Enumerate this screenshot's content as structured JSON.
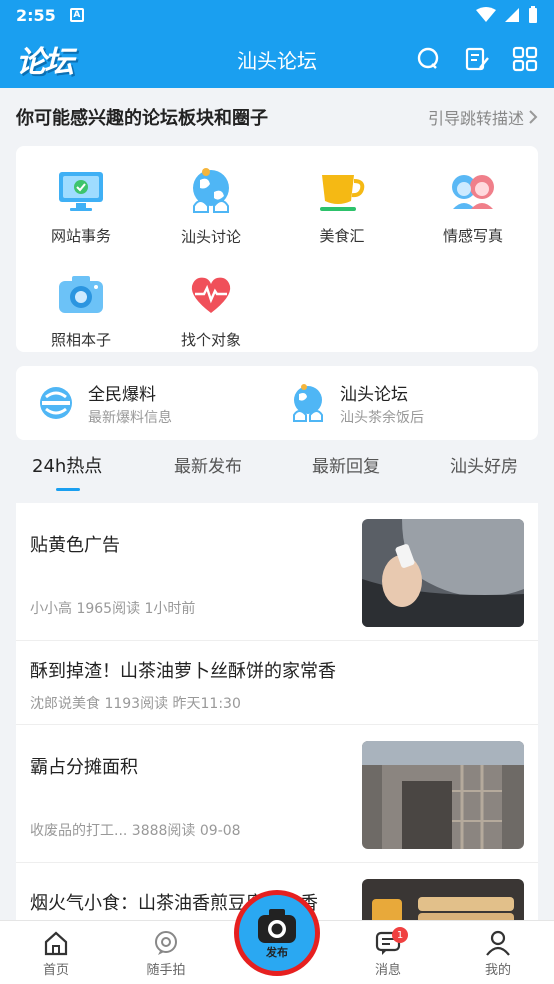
{
  "status": {
    "time": "2:55",
    "notif_letter": "A"
  },
  "app": {
    "logo": "论坛",
    "title": "汕头论坛"
  },
  "section": {
    "heading": "你可能感兴趣的论坛板块和圈子",
    "link": "引导跳转描述"
  },
  "categories": [
    {
      "label": "网站事务",
      "icon": "monitor-icon"
    },
    {
      "label": "汕头讨论",
      "icon": "globe-icon"
    },
    {
      "label": "美食汇",
      "icon": "cup-icon"
    },
    {
      "label": "情感写真",
      "icon": "couple-icon"
    },
    {
      "label": "照相本子",
      "icon": "camera-icon"
    },
    {
      "label": "找个对象",
      "icon": "heart-icon"
    }
  ],
  "quick": [
    {
      "title": "全民爆料",
      "subtitle": "最新爆料信息"
    },
    {
      "title": "汕头论坛",
      "subtitle": "汕头茶余饭后"
    }
  ],
  "tabs": [
    "24h热点",
    "最新发布",
    "最新回复",
    "汕头好房"
  ],
  "posts": [
    {
      "title": "贴黄色广告",
      "meta": "小小高 1965阅读   1小时前"
    },
    {
      "title": "酥到掉渣！山茶油萝卜丝酥饼的家常香",
      "meta": "沈郎说美食 1193阅读   昨天11:30"
    },
    {
      "title": "霸占分摊面积",
      "meta": "收废品的打工... 3888阅读   09-08"
    },
    {
      "title": "烟火气小食：山茶油香煎豆腐卷，香"
    }
  ],
  "nav": {
    "home": "首页",
    "snap": "随手拍",
    "publish": "发布",
    "messages": "消息",
    "messages_badge": "1",
    "mine": "我的"
  },
  "colors": {
    "primary": "#1a9ff0",
    "badge": "#f04040",
    "highlight_ring": "#e62020"
  }
}
